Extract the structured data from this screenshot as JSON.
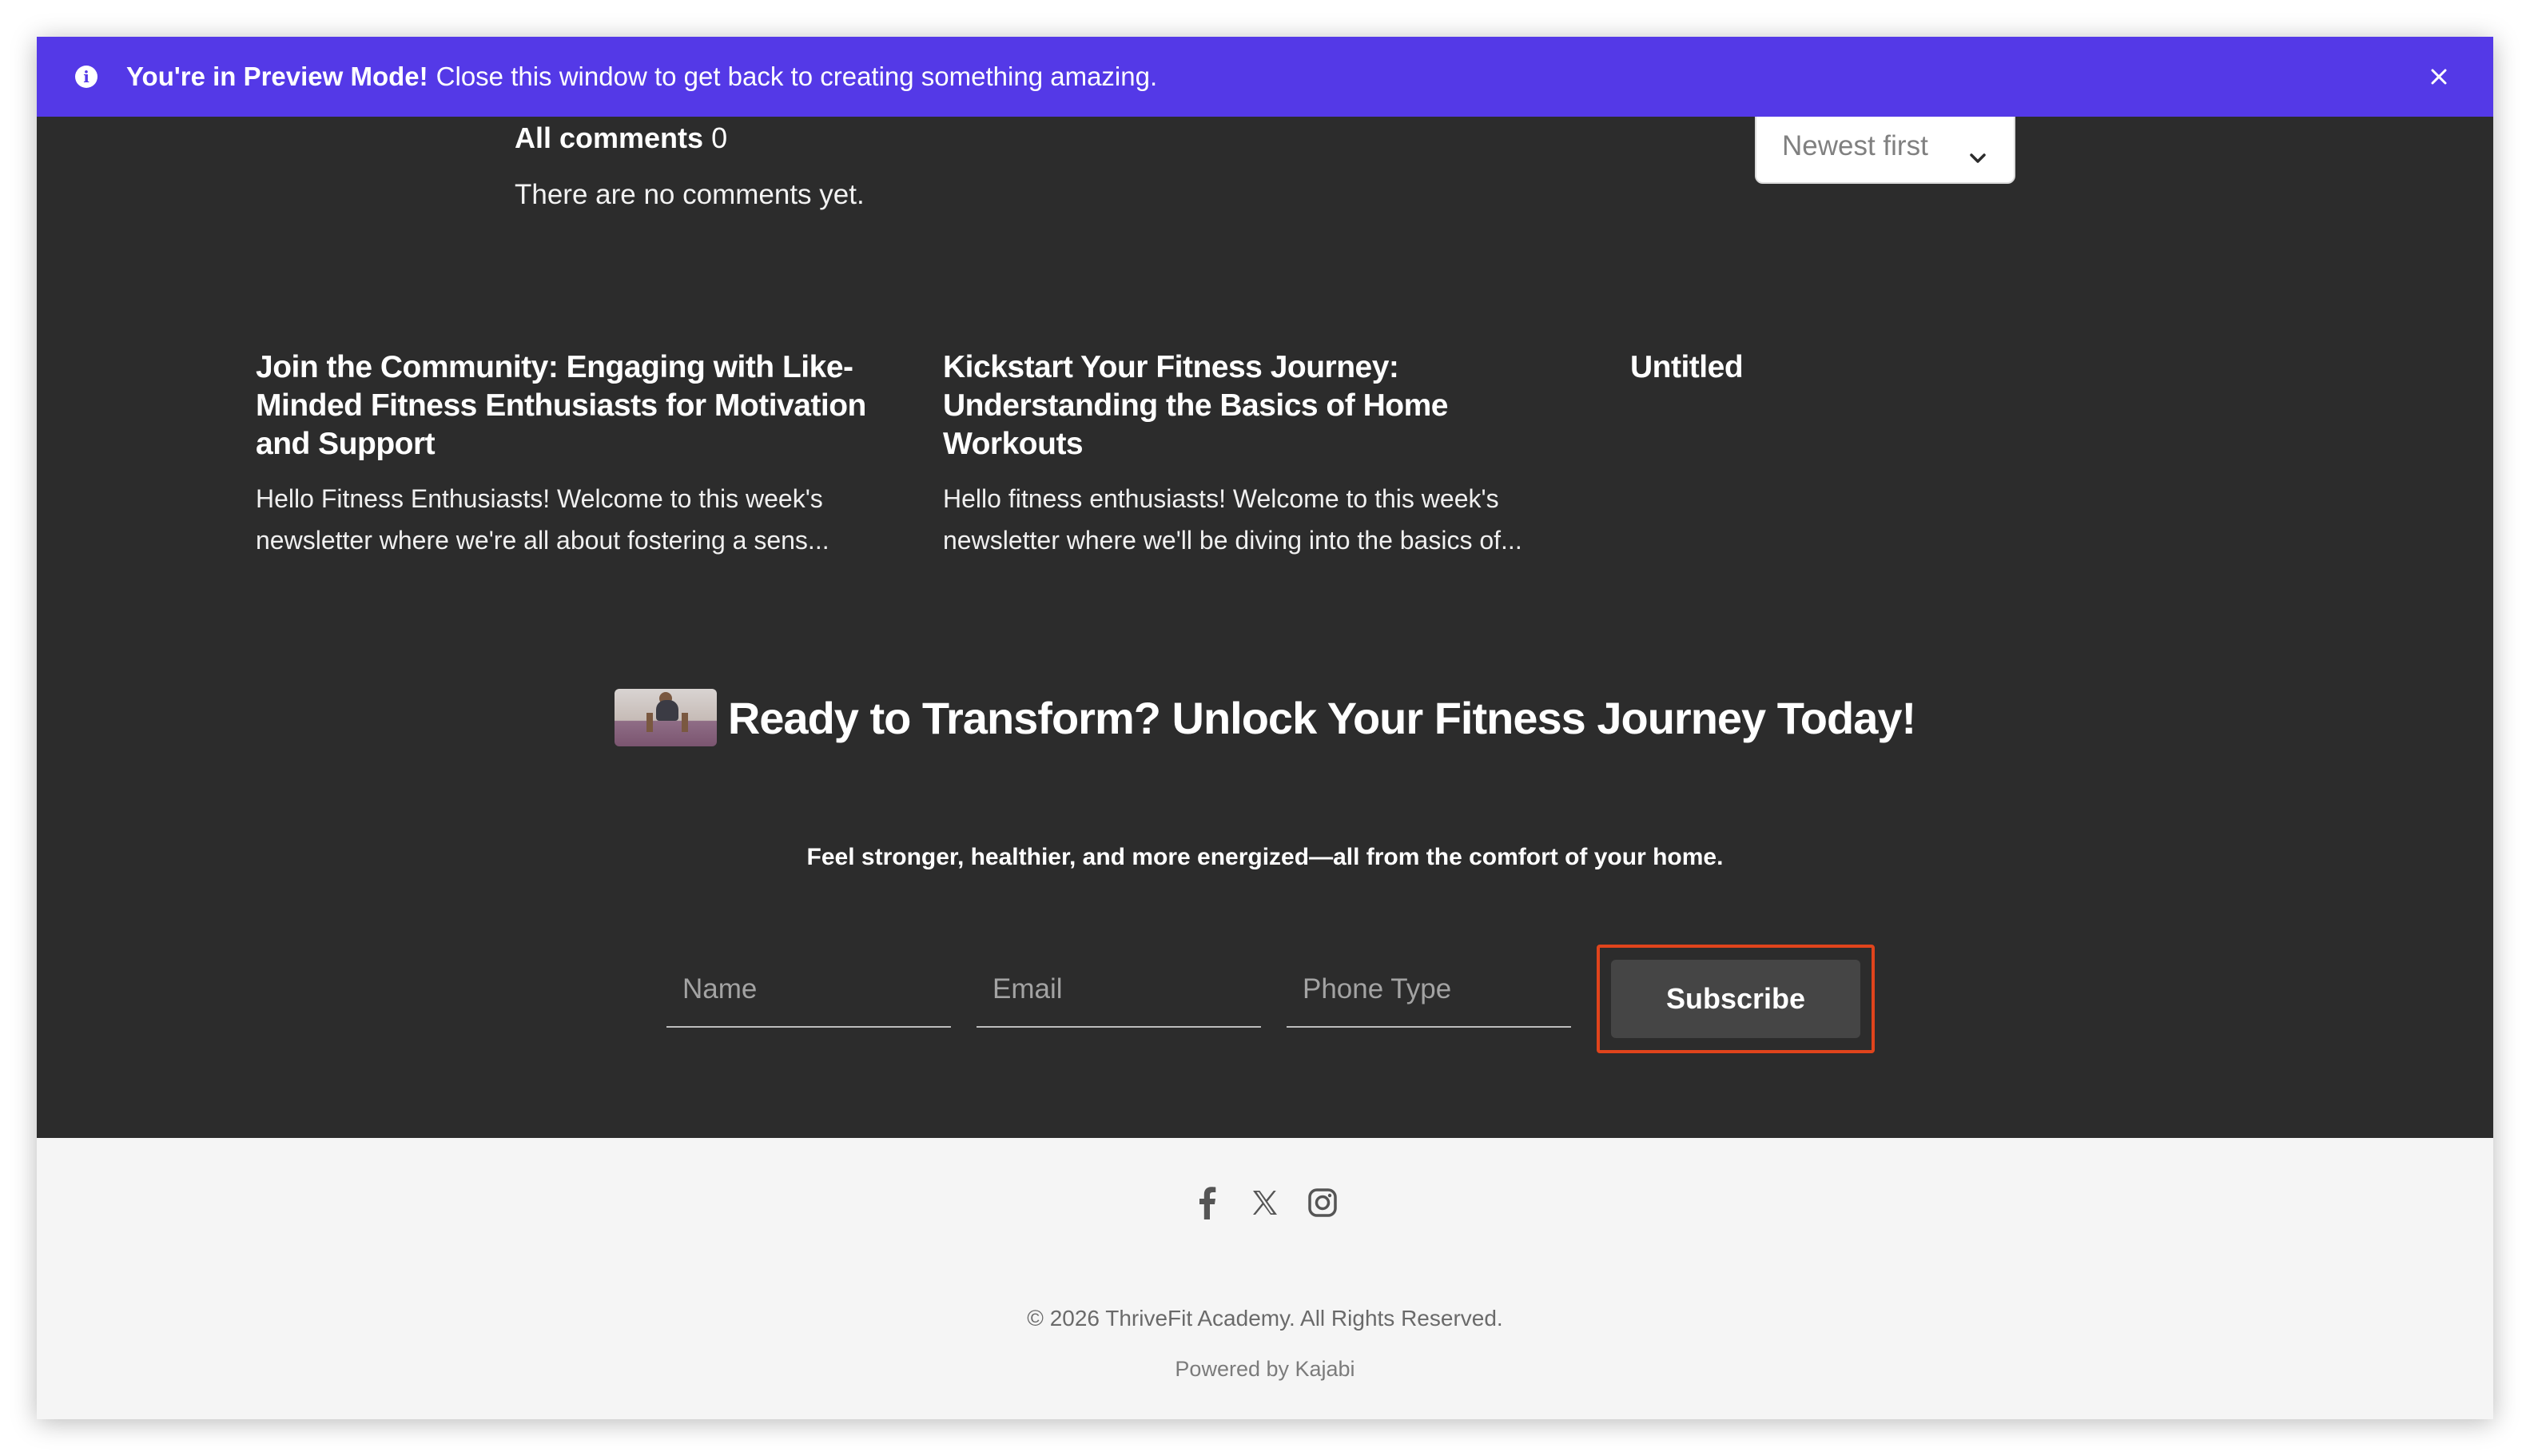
{
  "preview_banner": {
    "strong": "You're in Preview Mode!",
    "message": "Close this window to get back to creating something amazing.",
    "icon": "info-icon",
    "close_icon": "close-icon",
    "background": "#5439e7"
  },
  "comments": {
    "label": "All comments",
    "count": "0",
    "empty_text": "There are no comments yet.",
    "sort": {
      "selected": "Newest first",
      "icon": "chevron-down-icon"
    }
  },
  "posts": [
    {
      "title": "Join the Community: Engaging with Like-Minded Fitness Enthusiasts for Motivation and Support",
      "excerpt": "Hello Fitness Enthusiasts! Welcome to this week's newsletter where we're all about fostering a sens..."
    },
    {
      "title": "Kickstart Your Fitness Journey: Understanding the Basics of Home Workouts",
      "excerpt": "Hello fitness enthusiasts! Welcome to this week's newsletter where we'll be diving into the basics of..."
    },
    {
      "title": "Untitled",
      "excerpt": ""
    }
  ],
  "cta": {
    "title": "Ready to Transform? Unlock Your Fitness Journey Today!",
    "subtitle": "Feel stronger, healthier, and more energized—all from the comfort of your home.",
    "form": {
      "name_placeholder": "Name",
      "email_placeholder": "Email",
      "phone_placeholder": "Phone Type",
      "submit_label": "Subscribe"
    }
  },
  "footer": {
    "social": [
      "facebook-icon",
      "x-icon",
      "instagram-icon"
    ],
    "copyright": "© 2026 ThriveFit Academy. All Rights Reserved.",
    "powered_by": "Powered by Kajabi"
  },
  "colors": {
    "dark_section": "#2c2c2c",
    "footer_bg": "#f5f5f5",
    "highlight_border": "#e0441c"
  }
}
